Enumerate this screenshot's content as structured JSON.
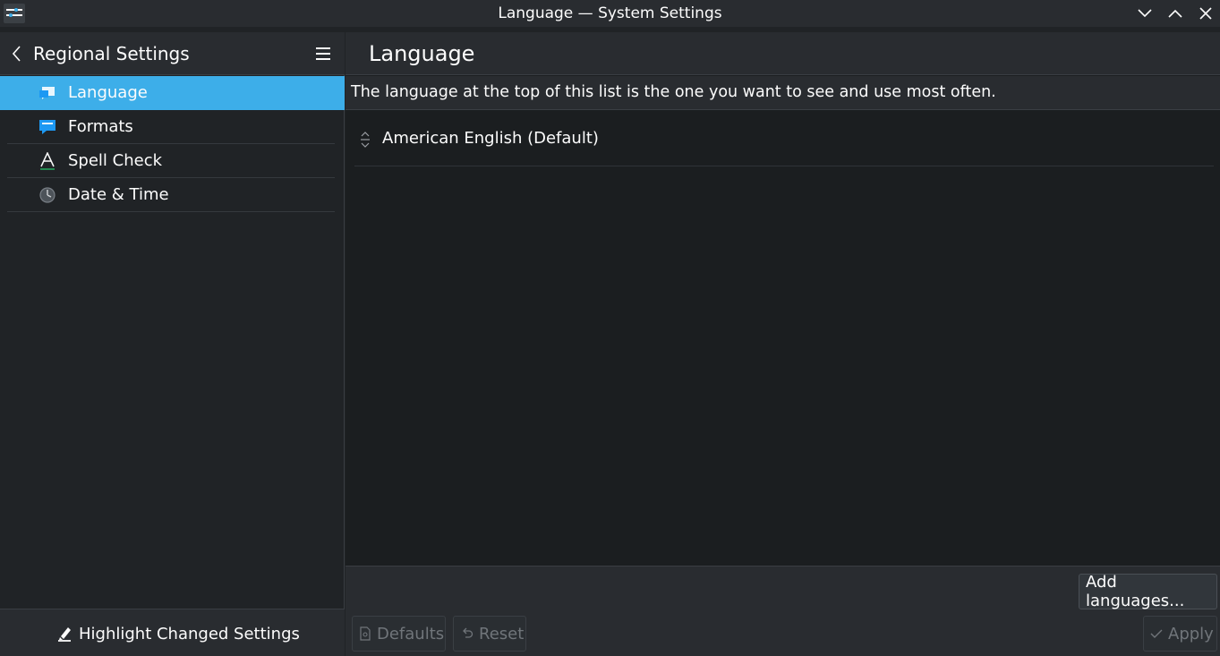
{
  "window": {
    "title": "Language — System Settings"
  },
  "sidebar": {
    "title": "Regional Settings",
    "items": [
      {
        "label": "Language",
        "icon": "language-icon",
        "selected": true
      },
      {
        "label": "Formats",
        "icon": "formats-icon",
        "selected": false
      },
      {
        "label": "Spell Check",
        "icon": "spell-check-icon",
        "selected": false
      },
      {
        "label": "Date & Time",
        "icon": "clock-icon",
        "selected": false
      }
    ],
    "footer_label": "Highlight Changed Settings"
  },
  "main": {
    "title": "Language",
    "info_text": "The language at the top of this list is the one you want to see and use most often.",
    "languages": [
      "American English (Default)"
    ],
    "add_button": "Add languages...",
    "defaults_button": "Defaults",
    "reset_button": "Reset",
    "apply_button": "Apply"
  },
  "colors": {
    "accent": "#3daee9",
    "background": "#1b1e20",
    "panel": "#292c30"
  }
}
